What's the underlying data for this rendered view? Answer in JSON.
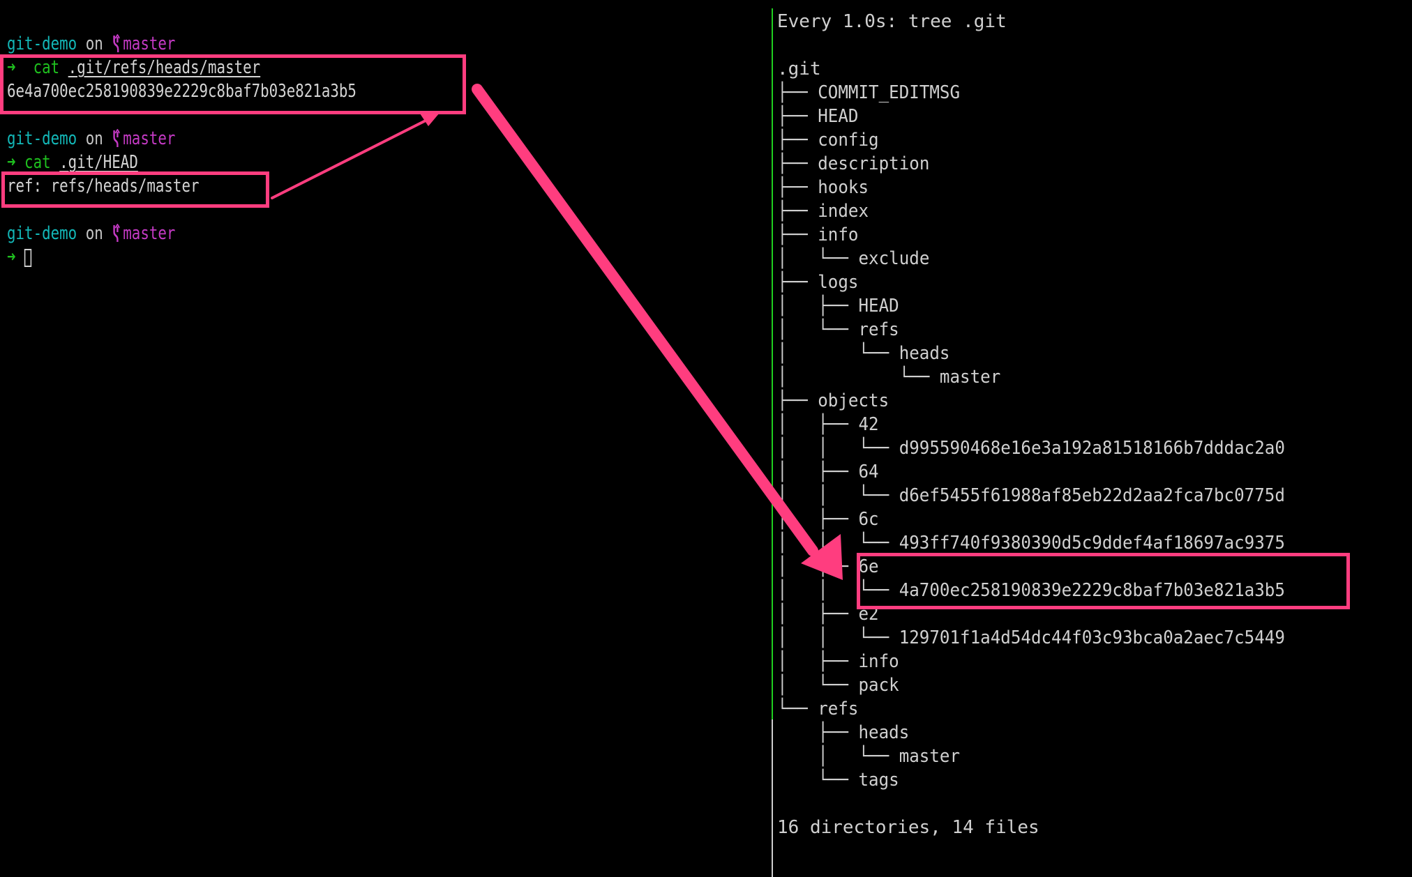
{
  "left_terminal": {
    "prompts": [
      {
        "dir": "git-demo",
        "on": "on",
        "branch_icon": "git-branch-icon",
        "branch": "master",
        "arrow": "➜",
        "command": "cat",
        "argument": ".git/refs/heads/master",
        "output": "6e4a700ec258190839e2229c8baf7b03e821a3b5"
      },
      {
        "dir": "git-demo",
        "on": "on",
        "branch_icon": "git-branch-icon",
        "branch": "master",
        "arrow": "➜",
        "command": "cat",
        "argument": ".git/HEAD",
        "output": "ref: refs/heads/master"
      },
      {
        "dir": "git-demo",
        "on": "on",
        "branch_icon": "git-branch-icon",
        "branch": "master",
        "arrow": "➜",
        "command": "",
        "argument": "",
        "output": ""
      }
    ]
  },
  "right_terminal": {
    "watch_header": "Every 1.0s: tree .git",
    "root": ".git",
    "tree": [
      {
        "prefix": "├── ",
        "name": "COMMIT_EDITMSG"
      },
      {
        "prefix": "├── ",
        "name": "HEAD"
      },
      {
        "prefix": "├── ",
        "name": "config"
      },
      {
        "prefix": "├── ",
        "name": "description"
      },
      {
        "prefix": "├── ",
        "name": "hooks"
      },
      {
        "prefix": "├── ",
        "name": "index"
      },
      {
        "prefix": "├── ",
        "name": "info"
      },
      {
        "prefix": "│   └── ",
        "name": "exclude"
      },
      {
        "prefix": "├── ",
        "name": "logs"
      },
      {
        "prefix": "│   ├── ",
        "name": "HEAD"
      },
      {
        "prefix": "│   └── ",
        "name": "refs"
      },
      {
        "prefix": "│       └── ",
        "name": "heads"
      },
      {
        "prefix": "│           └── ",
        "name": "master"
      },
      {
        "prefix": "├── ",
        "name": "objects"
      },
      {
        "prefix": "│   ├── ",
        "name": "42"
      },
      {
        "prefix": "│   │   └── ",
        "name": "d995590468e16e3a192a81518166b7dddac2a0"
      },
      {
        "prefix": "│   ├── ",
        "name": "64"
      },
      {
        "prefix": "│   │   └── ",
        "name": "d6ef5455f61988af85eb22d2aa2fca7bc0775d"
      },
      {
        "prefix": "│   ├── ",
        "name": "6c"
      },
      {
        "prefix": "│   │   └── ",
        "name": "493ff740f9380390d5c9ddef4af18697ac9375"
      },
      {
        "prefix": "│   ├── ",
        "name": "6e"
      },
      {
        "prefix": "│   │   └── ",
        "name": "4a700ec258190839e2229c8baf7b03e821a3b5"
      },
      {
        "prefix": "│   ├── ",
        "name": "e2"
      },
      {
        "prefix": "│   │   └── ",
        "name": "129701f1a4d54dc44f03c93bca0a2aec7c5449"
      },
      {
        "prefix": "│   ├── ",
        "name": "info"
      },
      {
        "prefix": "│   └── ",
        "name": "pack"
      },
      {
        "prefix": "└── ",
        "name": "refs"
      },
      {
        "prefix": "    ├── ",
        "name": "heads"
      },
      {
        "prefix": "    │   └── ",
        "name": "master"
      },
      {
        "prefix": "    └── ",
        "name": "tags"
      }
    ],
    "summary": "16 directories, 14 files"
  },
  "annotations": {
    "highlight_color": "#ff3d7f",
    "boxes": [
      "ref-file-output-box",
      "head-output-box",
      "object-6e-box"
    ],
    "arrows": [
      "head-to-ref-arrow",
      "ref-to-object-arrow"
    ]
  },
  "colors": {
    "background": "#000000",
    "dir": "#13b8b8",
    "branch": "#c43ac4",
    "command": "#1fc01f",
    "text": "#d0d0d0",
    "pane_divider_active": "#1fcf1f"
  }
}
